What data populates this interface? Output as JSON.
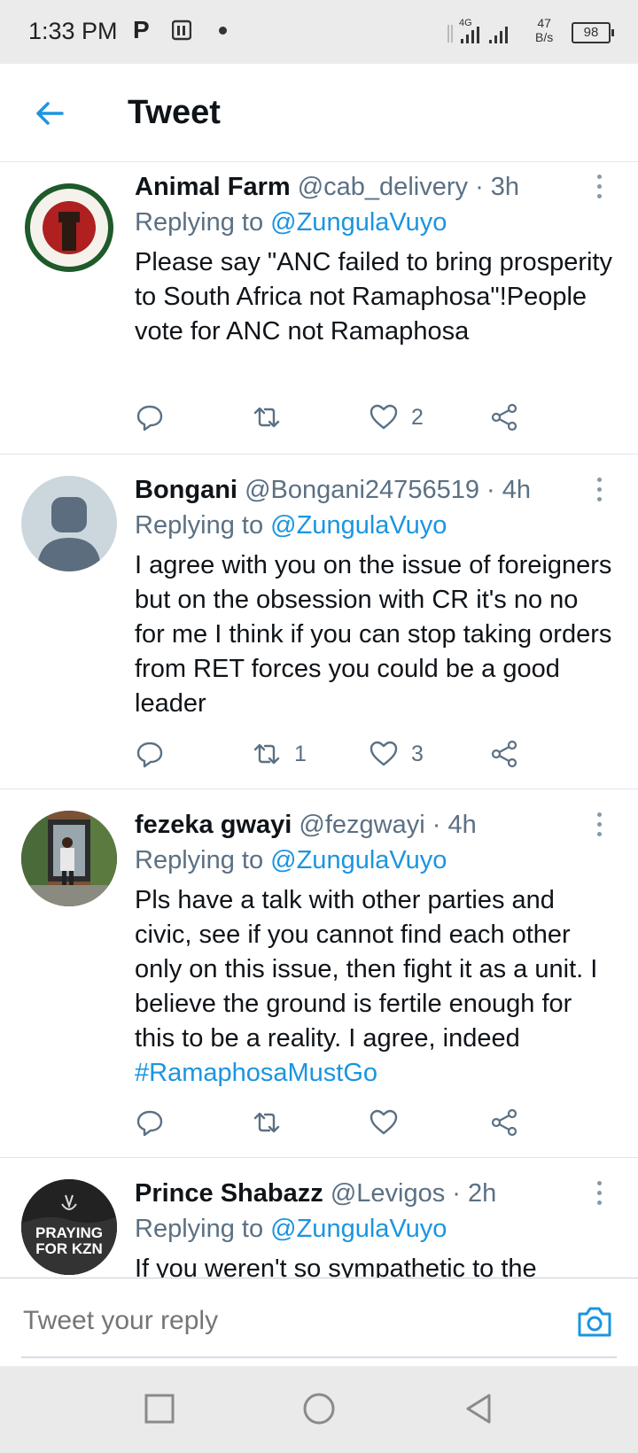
{
  "status_bar": {
    "time": "1:33 PM",
    "p_icon": "P",
    "network": "4G",
    "speed_value": "47",
    "speed_unit": "B/s",
    "battery": "98"
  },
  "header": {
    "title": "Tweet",
    "back_icon": "arrow-left-icon"
  },
  "tweets": [
    {
      "name": "Animal Farm",
      "handle": "@cab_delivery",
      "time": "3h",
      "replying_prefix": "Replying to",
      "replying_to": "@ZungulaVuyo",
      "text": "Please say \"ANC failed to bring prosperity to South Africa not Ramaphosa\"!People vote for ANC not Ramaphosa",
      "hashtag": "",
      "replies": "",
      "retweets": "",
      "likes": "2"
    },
    {
      "name": "Bongani",
      "handle": "@Bongani24756519",
      "time": "4h",
      "replying_prefix": "Replying to",
      "replying_to": "@ZungulaVuyo",
      "text": "I agree with you on the issue of foreigners but on the obsession with CR it's no no for me I think if you can stop taking orders from RET forces you could be a good leader",
      "hashtag": "",
      "replies": "",
      "retweets": "1",
      "likes": "3"
    },
    {
      "name": "fezeka gwayi",
      "handle": "@fezgwayi",
      "time": "4h",
      "replying_prefix": "Replying to",
      "replying_to": "@ZungulaVuyo",
      "text": "Pls have a talk with other parties and civic, see if you cannot find each other only on this issue, then fight it as a unit. I believe the ground is fertile enough for this to be a reality. I agree, indeed",
      "hashtag": "#RamaphosaMustGo",
      "replies": "",
      "retweets": "",
      "likes": ""
    },
    {
      "name": "Prince Shabazz",
      "handle": "@Levigos",
      "time": "2h",
      "replying_prefix": "Replying to",
      "replying_to": "@ZungulaVuyo",
      "text": "If you weren't so sympathetic to the",
      "avatar_text_1": "PRAYING",
      "avatar_text_2": "FOR KZN"
    }
  ],
  "composer": {
    "placeholder": "Tweet your reply",
    "camera_icon": "camera-icon"
  },
  "colors": {
    "accent": "#1b95e0",
    "secondary_text": "#5b7083",
    "status_bar_bg": "#ebebeb"
  }
}
